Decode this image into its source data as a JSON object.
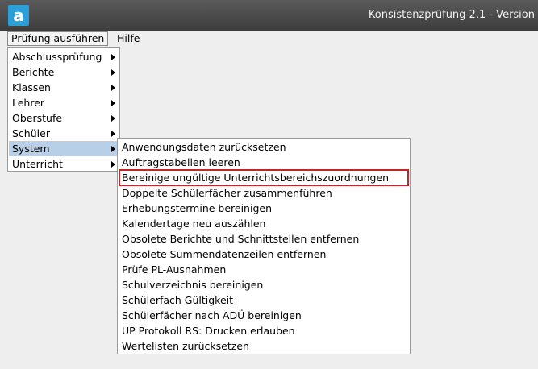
{
  "window": {
    "title": "Konsistenzprüfung 2.1 - Version",
    "app_icon_letter": "a"
  },
  "menubar": {
    "items": [
      {
        "label": "Prüfung ausführen"
      },
      {
        "label": "Hilfe"
      }
    ]
  },
  "menu": {
    "items": [
      {
        "label": "Abschlussprüfung"
      },
      {
        "label": "Berichte"
      },
      {
        "label": "Klassen"
      },
      {
        "label": "Lehrer"
      },
      {
        "label": "Oberstufe"
      },
      {
        "label": "Schüler"
      },
      {
        "label": "System"
      },
      {
        "label": "Unterricht"
      }
    ]
  },
  "submenu": {
    "items": [
      {
        "label": "Anwendungsdaten zurücksetzen"
      },
      {
        "label": "Auftragstabellen leeren"
      },
      {
        "label": "Bereinige ungültige Unterrichtsbereichszuordnungen"
      },
      {
        "label": "Doppelte Schülerfächer zusammenführen"
      },
      {
        "label": "Erhebungstermine bereinigen"
      },
      {
        "label": "Kalendertage neu auszählen"
      },
      {
        "label": "Obsolete Berichte und Schnittstellen entfernen"
      },
      {
        "label": "Obsolete Summendatenzeilen entfernen"
      },
      {
        "label": "Prüfe PL-Ausnahmen"
      },
      {
        "label": "Schulverzeichnis bereinigen"
      },
      {
        "label": "Schülerfach Gültigkeit"
      },
      {
        "label": "Schülerfächer nach ADÜ bereinigen"
      },
      {
        "label": "UP Protokoll RS: Drucken erlauben"
      },
      {
        "label": "Wertelisten zurücksetzen"
      }
    ]
  },
  "colors": {
    "selection": "#b8cfe8",
    "highlight_border": "#c0262b",
    "app_icon": "#2a9fd8"
  }
}
